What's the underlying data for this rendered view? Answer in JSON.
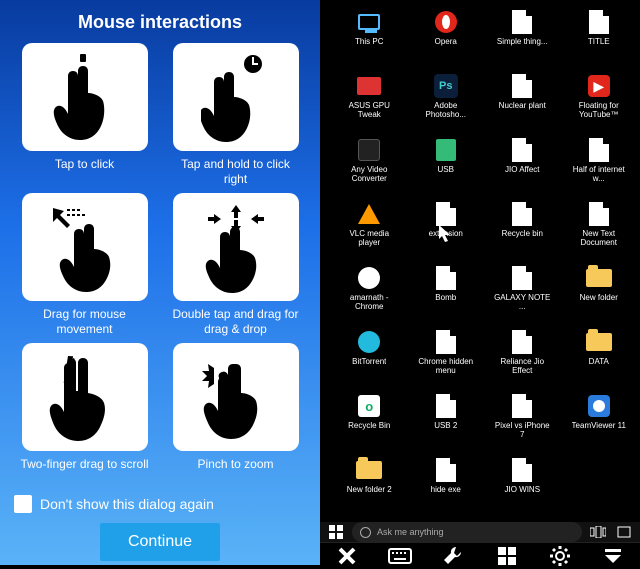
{
  "dialog": {
    "title": "Mouse interactions",
    "cards": [
      {
        "id": "tap",
        "caption": "Tap to click"
      },
      {
        "id": "hold",
        "caption": "Tap and hold to click right"
      },
      {
        "id": "drag",
        "caption": "Drag for mouse movement"
      },
      {
        "id": "dbltap",
        "caption": "Double tap and drag for drag & drop"
      },
      {
        "id": "twofinger",
        "caption": "Two-finger drag to scroll"
      },
      {
        "id": "pinch",
        "caption": "Pinch to zoom"
      }
    ],
    "checkbox_label": "Don't show this dialog again",
    "continue_label": "Continue"
  },
  "desktop": {
    "icons": [
      {
        "name": "This PC",
        "glyph": "pc"
      },
      {
        "name": "Opera",
        "glyph": "opera"
      },
      {
        "name": "Simple thing...",
        "glyph": "file"
      },
      {
        "name": "TITLE",
        "glyph": "file"
      },
      {
        "name": "ASUS GPU Tweak",
        "glyph": "asus"
      },
      {
        "name": "Adobe Photosho...",
        "glyph": "ps"
      },
      {
        "name": "Nuclear plant",
        "glyph": "file"
      },
      {
        "name": "Floating for YouTube™",
        "glyph": "float"
      },
      {
        "name": "Any Video Converter",
        "glyph": "avc"
      },
      {
        "name": "USB",
        "glyph": "usb"
      },
      {
        "name": "JIO Affect",
        "glyph": "file"
      },
      {
        "name": "Half of internet w...",
        "glyph": "file"
      },
      {
        "name": "VLC media player",
        "glyph": "vlc"
      },
      {
        "name": "extension",
        "glyph": "file"
      },
      {
        "name": "Recycle bin",
        "glyph": "file"
      },
      {
        "name": "New Text Document",
        "glyph": "file"
      },
      {
        "name": "amarnath - Chrome",
        "glyph": "amar"
      },
      {
        "name": "Bomb",
        "glyph": "file"
      },
      {
        "name": "GALAXY NOTE ...",
        "glyph": "file"
      },
      {
        "name": "New folder",
        "glyph": "folder"
      },
      {
        "name": "BitTorrent",
        "glyph": "bt"
      },
      {
        "name": "Chrome hidden menu",
        "glyph": "file"
      },
      {
        "name": "Reliance Jio Effect",
        "glyph": "file"
      },
      {
        "name": "DATA",
        "glyph": "folder"
      },
      {
        "name": "Recycle Bin",
        "glyph": "outlook"
      },
      {
        "name": "USB 2",
        "glyph": "file"
      },
      {
        "name": "Pixel vs iPhone 7",
        "glyph": "file"
      },
      {
        "name": "TeamViewer 11",
        "glyph": "tv"
      },
      {
        "name": "New folder 2",
        "glyph": "folder"
      },
      {
        "name": "hide exe",
        "glyph": "file"
      },
      {
        "name": "JIO WINS",
        "glyph": "file"
      }
    ]
  },
  "taskbar": {
    "search_placeholder": "Ask me anything"
  },
  "toolbar": {
    "items": [
      "close",
      "keyboard",
      "wrench",
      "windows",
      "gear",
      "dropdown"
    ]
  }
}
